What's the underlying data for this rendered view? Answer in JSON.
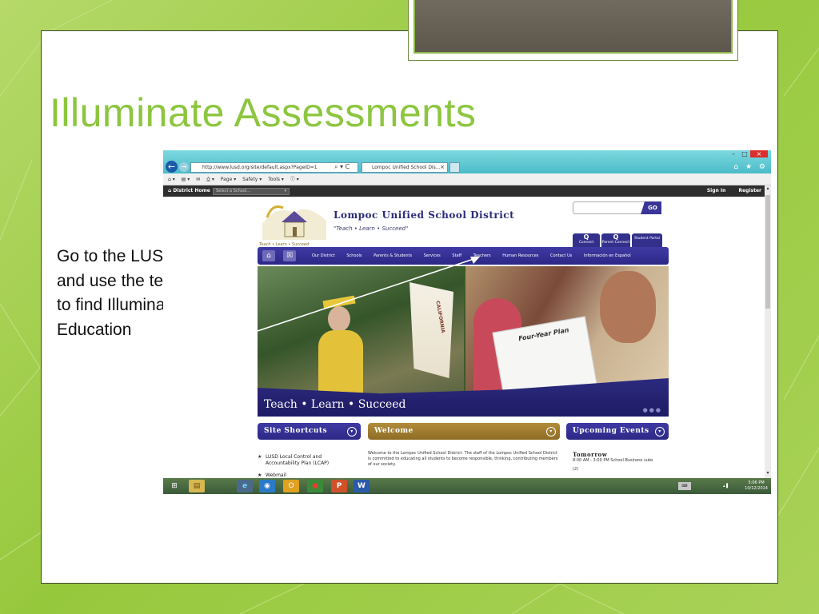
{
  "slide": {
    "title": "Illuminate Assessments",
    "body": "Go to the LUSD Website and use the teacher tab to find Illuminate Education"
  },
  "browser": {
    "url": "http://www.lusd.org/site/default.aspx?PageID=1",
    "addr_controls": "⌕ ▾ C",
    "tab_title": "Lompoc Unified School Dis...",
    "tab_close": "×",
    "window_controls": [
      "–",
      "□",
      "×"
    ],
    "toolbar_icons": "⌂ ★ ⚙",
    "command_bar": [
      "⌂ ▾",
      "▤ ▾",
      "✉",
      "⎙ ▾",
      "Page ▾",
      "Safety ▾",
      "Tools ▾",
      "ⓘ ▾"
    ]
  },
  "district_bar": {
    "home": "⌂ District Home",
    "select_placeholder": "Select a School...",
    "select_arrow": "▾",
    "sign_in": "Sign In",
    "register": "Register"
  },
  "site": {
    "name": "Lompoc Unified School District",
    "tagline": "\"Teach • Learn • Succeed\"",
    "logo_tag": "Teach • Learn • Succeed",
    "go_label": "GO",
    "quick_links": [
      {
        "icon": "Q",
        "label": "Connect"
      },
      {
        "icon": "Q",
        "label": "Parent Connect"
      },
      {
        "icon": "",
        "label": "Student Portal"
      }
    ],
    "nav_icons": [
      "⌂",
      "☒"
    ],
    "nav": [
      "Our District",
      "Schools",
      "Parents & Students",
      "Services",
      "Staff",
      "Teachers",
      "Human Resources",
      "Contact Us",
      "Información en Español"
    ],
    "hero_caption": "Teach • Learn • Succeed",
    "hero_dots": "●●●",
    "hero_paper_title": "Four-Year Plan",
    "flag_text": "CALIFORNIA",
    "sections": [
      "Site Shortcuts",
      "Welcome",
      "Upcoming Events"
    ],
    "section_expand": "▾",
    "shortcuts": [
      {
        "bullet": "★",
        "text": "LUSD Local Control and Accountability Plan (LCAP)"
      },
      {
        "bullet": "★",
        "text": "Webmail"
      }
    ],
    "welcome": "Welcome to the Lompoc Unified School District. The staff of the Lompoc Unified School District is committed to educating all students to become responsible, thinking, contributing members of our society.",
    "events_head": "Tomorrow",
    "events_line": "8:00 AM - 3:00 PM School Business subs",
    "events_count": "(2)"
  },
  "scrollbar": {
    "up": "▴",
    "down": "▾"
  },
  "taskbar": {
    "start": "⊞",
    "explorer": "▤",
    "ie": "e",
    "apps": [
      "◉",
      "O",
      "●",
      "P",
      "W"
    ],
    "keyboard": "⌨",
    "tray": "▴  ▌",
    "time": "5:06 PM",
    "date": "10/12/2014"
  }
}
